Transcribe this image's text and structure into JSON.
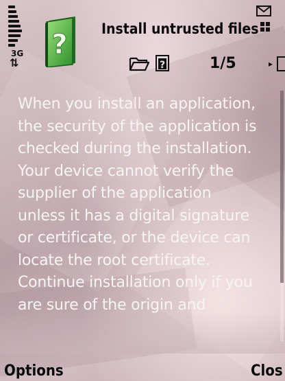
{
  "status": {
    "network": "3G",
    "network_arrows": "⇅",
    "signal_icon": "signal-strength-icon",
    "message_icon": "message-icon",
    "menu_grid_icon": "menu-grid-icon"
  },
  "header": {
    "app_icon": "question-mark-box-icon",
    "title": "Install untrusted files",
    "page_counter": "1/5",
    "next_arrow": "▸"
  },
  "content": {
    "body": "When you install an application,\nthe security of the application is\nchecked during the installation.\nYour device cannot verify the\nsupplier of the application\nunless it has a digital signature\nor certificate, or the device can\nlocate the root certificate.\nContinue installation only if you\nare sure of the origin and"
  },
  "softkeys": {
    "left": "Options",
    "right": "Clos"
  },
  "colors": {
    "text": "#f7f4f4",
    "header_text": "#0b0b0b",
    "icon_green": "#3fa83a"
  }
}
